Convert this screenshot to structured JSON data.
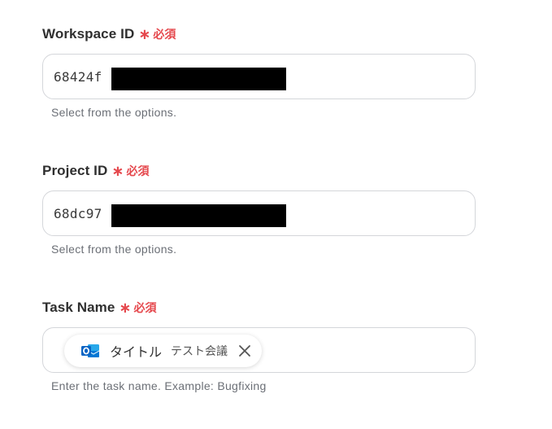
{
  "required_mark": "∗",
  "required_text": "必須",
  "fields": {
    "workspace": {
      "label": "Workspace ID",
      "value": "68424f",
      "hint": "Select from the options."
    },
    "project": {
      "label": "Project ID",
      "value": "68dc97",
      "hint": "Select from the options."
    },
    "task_name": {
      "label": "Task Name",
      "chip": {
        "icon": "outlook-icon",
        "label": "タイトル",
        "sub": "テスト会議"
      },
      "hint": "Enter the task name. Example: Bugfixing"
    }
  },
  "colors": {
    "required": "#e5484d",
    "outlook_blue": "#0a64c4"
  }
}
